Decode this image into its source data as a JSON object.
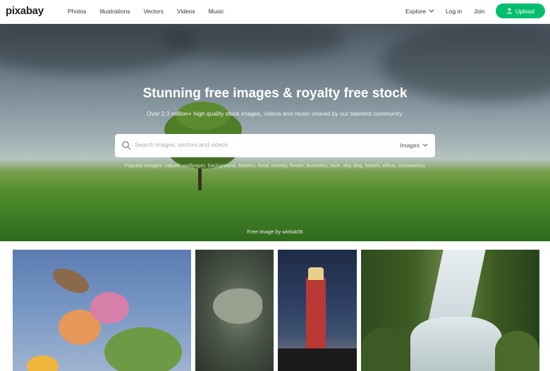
{
  "header": {
    "logo": "pixabay",
    "nav": [
      "Photos",
      "Illustrations",
      "Vectors",
      "Videos",
      "Music"
    ],
    "explore": "Explore",
    "login": "Log in",
    "join": "Join",
    "upload": "Upload",
    "accent_color": "#02be6e"
  },
  "hero": {
    "title": "Stunning free images & royalty free stock",
    "subtitle": "Over 2.3 million+ high quality stock images, videos and music shared by our talented community.",
    "search": {
      "placeholder": "Search images, vectors and videos",
      "type": "Images"
    },
    "popular": "Popular Images: nature, wallpaper, background, flowers, food, money, flower, business, love, sky, dog, beach, office, coronavirus",
    "credit": "Free image by winluk06"
  },
  "gallery": {
    "photos": [
      "butterfly-flowers-photo",
      "fish-photo",
      "lighthouse-photo",
      "waterfall-photo"
    ]
  }
}
